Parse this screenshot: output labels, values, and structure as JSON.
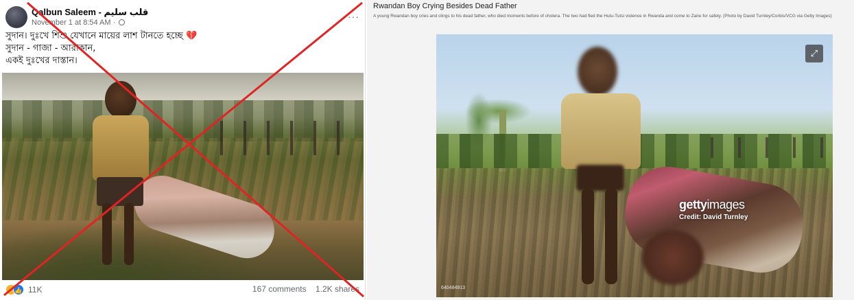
{
  "post": {
    "author": "Qalbun Saleem - قلب سليم",
    "timestamp": "November 1 at 8:54 AM",
    "more_icon": "more-horizontal-icon",
    "lines": [
      "সুদান। দুঃখে শিশু যেখানে মায়ের লাশ টানতে হচ্ছে",
      "সুদান - গাজা - আরাকান,",
      "একই দুঃখের দাস্তান।"
    ],
    "emoji": "💔",
    "reaction_count": "11K",
    "comments": "167 comments",
    "shares": "1.2K shares",
    "cross_color": "#e02424"
  },
  "stock": {
    "title": "Rwandan Boy Crying Besides Dead Father",
    "caption": "A young Rwandan boy cries and clings to his dead father, who died moments before of cholera. The two had fled the Hutu-Tutsi violence in Rwanda and come to Zaire for safety. (Photo by David Turnley/Corbis/VCG via Getty Images)",
    "watermark_brand": "getty",
    "watermark_brand_suffix": "images",
    "watermark_credit": "Credit: David Turnley",
    "photo_id": "640484913",
    "expand_icon": "expand-icon"
  }
}
